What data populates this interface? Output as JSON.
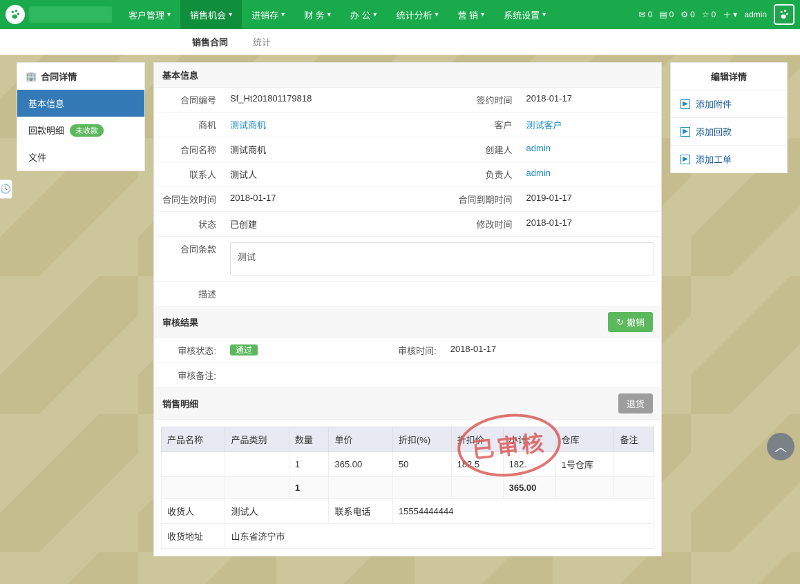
{
  "topnav": {
    "items": [
      "客户管理",
      "销售机会",
      "进销存",
      "财 务",
      "办 公",
      "统计分析",
      "营 销",
      "系统设置"
    ],
    "active_index": 1,
    "stats": {
      "mail": "0",
      "contacts": "0",
      "gear": "0",
      "star": "0"
    },
    "user": "admin"
  },
  "subnav": {
    "items": [
      "销售合同",
      "统计"
    ],
    "active_index": 0
  },
  "left": {
    "title": "合同详情",
    "items": [
      {
        "label": "基本信息",
        "active": true
      },
      {
        "label": "回款明细",
        "badge": "未收款"
      },
      {
        "label": "文件"
      }
    ]
  },
  "basic": {
    "title": "基本信息",
    "rows": [
      [
        "合同编号",
        "Sf_Ht201801179818",
        "签约时间",
        "2018-01-17"
      ],
      [
        "商机",
        "测试商机",
        "客户",
        "测试客户"
      ],
      [
        "合同名称",
        "测试商机",
        "创建人",
        "admin"
      ],
      [
        "联系人",
        "测试人",
        "负责人",
        "admin"
      ],
      [
        "合同生效时间",
        "2018-01-17",
        "合同到期时间",
        "2019-01-17"
      ],
      [
        "状态",
        "已创建",
        "修改时间",
        "2018-01-17"
      ]
    ],
    "terms_label": "合同条款",
    "terms": "测试",
    "desc_label": "描述",
    "desc": ""
  },
  "audit": {
    "title": "审核结果",
    "revoke": "撤销",
    "status_label": "审核状态:",
    "status": "通过",
    "time_label": "审核时间:",
    "time": "2018-01-17",
    "remark_label": "审核备注:",
    "remark": ""
  },
  "sales": {
    "title": "销售明细",
    "return_btn": "退货",
    "headers": [
      "产品名称",
      "产品类别",
      "数量",
      "单价",
      "折扣(%)",
      "折扣价",
      "小计",
      "仓库",
      "备注"
    ],
    "row": [
      "",
      "",
      "1",
      "365.00",
      "50",
      "182.5",
      "182.",
      "1号仓库",
      ""
    ],
    "totals": {
      "qty": "1",
      "subtotal": "365.00"
    },
    "consignee_label": "收货人",
    "consignee": "测试人",
    "phone_label": "联系电话",
    "phone": "15554444444",
    "addr_label": "收货地址",
    "addr": "山东省济宁市"
  },
  "right": {
    "title": "编辑详情",
    "items": [
      "添加附件",
      "添加回款",
      "添加工单"
    ]
  },
  "stamp": "已审核"
}
